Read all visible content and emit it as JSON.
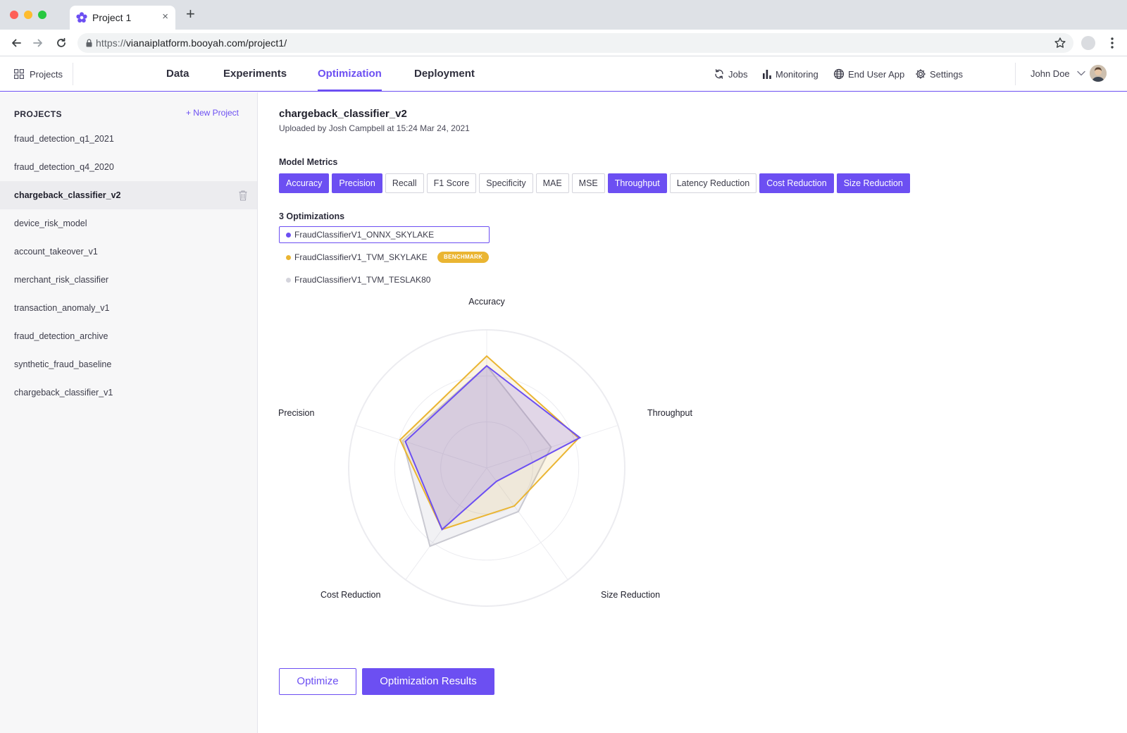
{
  "browser": {
    "tab_title": "Project 1",
    "tab_close": "×",
    "new_tab": "+",
    "url_scheme": "https://",
    "url_rest": "vianaiplatform.booyah.com/project1/"
  },
  "header": {
    "projects_label": "Projects",
    "tabs": [
      {
        "label": "Data",
        "active": false
      },
      {
        "label": "Experiments",
        "active": false
      },
      {
        "label": "Optimization",
        "active": true
      },
      {
        "label": "Deployment",
        "active": false
      }
    ],
    "links": {
      "jobs": "Jobs",
      "monitoring": "Monitoring",
      "end_user_app": "End User App",
      "settings": "Settings"
    },
    "user_name": "John Doe"
  },
  "sidebar": {
    "heading": "PROJECTS",
    "new_project": "+ New Project",
    "items": [
      {
        "label": "fraud_detection_q1_2021",
        "active": false
      },
      {
        "label": "fraud_detection_q4_2020",
        "active": false
      },
      {
        "label": "chargeback_classifier_v2",
        "active": true
      },
      {
        "label": "device_risk_model",
        "active": false
      },
      {
        "label": "account_takeover_v1",
        "active": false
      },
      {
        "label": "merchant_risk_classifier",
        "active": false
      },
      {
        "label": "transaction_anomaly_v1",
        "active": false
      },
      {
        "label": "fraud_detection_archive",
        "active": false
      },
      {
        "label": "synthetic_fraud_baseline",
        "active": false
      },
      {
        "label": "chargeback_classifier_v1",
        "active": false
      }
    ]
  },
  "main": {
    "title": "chargeback_classifier_v2",
    "subtitle": "Uploaded by Josh Campbell at 15:24 Mar 24, 2021",
    "metrics_label": "Model Metrics",
    "metrics": [
      {
        "label": "Accuracy",
        "selected": true
      },
      {
        "label": "Precision",
        "selected": true
      },
      {
        "label": "Recall",
        "selected": false
      },
      {
        "label": "F1 Score",
        "selected": false
      },
      {
        "label": "Specificity",
        "selected": false
      },
      {
        "label": "MAE",
        "selected": false
      },
      {
        "label": "MSE",
        "selected": false
      },
      {
        "label": "Throughput",
        "selected": true
      },
      {
        "label": "Latency Reduction",
        "selected": false
      },
      {
        "label": "Cost Reduction",
        "selected": true
      },
      {
        "label": "Size Reduction",
        "selected": true
      }
    ],
    "optimizations_label": "3 Optimizations",
    "optimizations": [
      {
        "label": "FraudClassifierV1_ONNX_SKYLAKE",
        "color": "#6c4ff2",
        "selected": true,
        "badge": ""
      },
      {
        "label": "FraudClassifierV1_TVM_SKYLAKE",
        "color": "#eab532",
        "selected": false,
        "badge": "BENCHMARK"
      },
      {
        "label": "FraudClassifierV1_TVM_TESLAK80",
        "color": "#d4d4dc",
        "selected": false,
        "badge": ""
      }
    ],
    "buttons": {
      "optimize": "Optimize",
      "results": "Optimization Results"
    }
  },
  "chart_data": {
    "type": "radar",
    "axes": [
      "Accuracy",
      "Throughput",
      "Size Reduction",
      "Cost Reduction",
      "Precision"
    ],
    "range": [
      0,
      1
    ],
    "rings": 3,
    "series": [
      {
        "name": "FraudClassifierV1_TVM_TESLAK80",
        "color": "#c9c9d1",
        "fill": "rgba(180,180,195,0.18)",
        "values": [
          0.74,
          0.49,
          0.39,
          0.7,
          0.64
        ]
      },
      {
        "name": "FraudClassifierV1_TVM_SKYLAKE",
        "color": "#eab532",
        "fill": "rgba(234,181,50,0.13)",
        "values": [
          0.81,
          0.7,
          0.34,
          0.55,
          0.66
        ]
      },
      {
        "name": "FraudClassifierV1_ONNX_SKYLAKE",
        "color": "#6c4ff2",
        "fill": "rgba(108,79,242,0.18)",
        "values": [
          0.74,
          0.71,
          0.12,
          0.55,
          0.62
        ]
      }
    ]
  }
}
